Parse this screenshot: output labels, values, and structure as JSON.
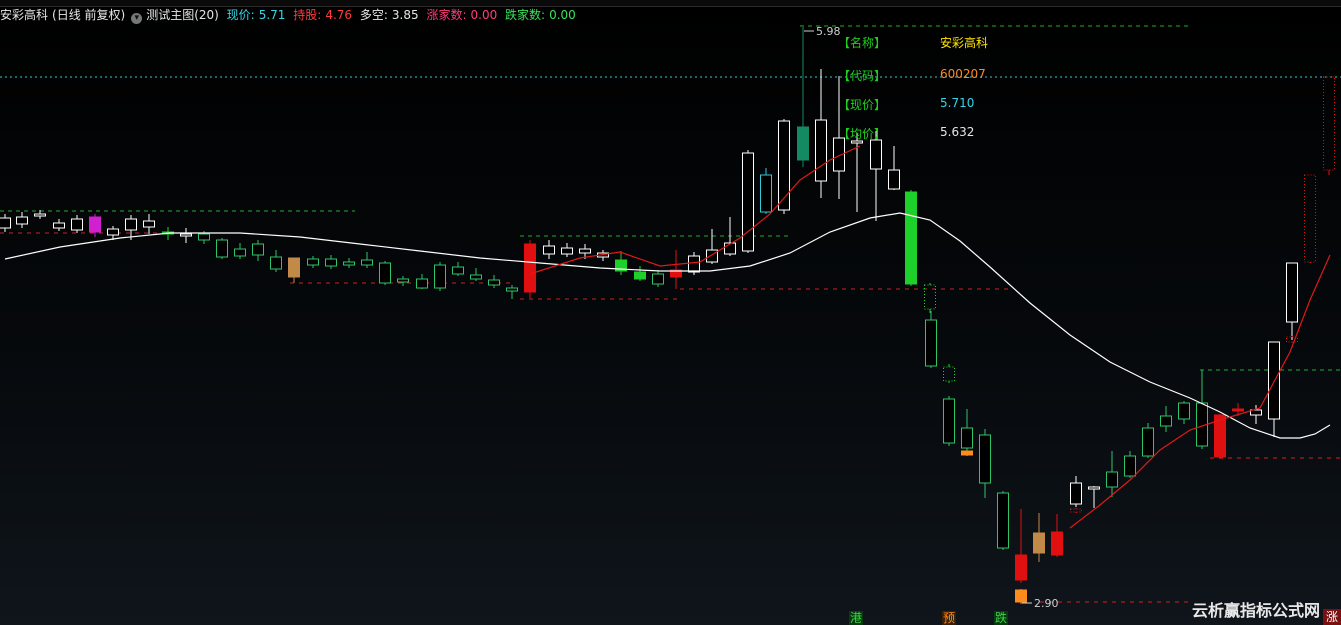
{
  "title_bar": {
    "stock": "安彩高科",
    "period": "(日线 前复权)",
    "indicator": "测试主图(20)",
    "now_label": "现价:",
    "now_value": "5.71",
    "hold_label": "持股:",
    "hold_value": "4.76",
    "dk_label": "多空:",
    "dk_value": "3.85",
    "up_label": "涨家数:",
    "up_value": "0.00",
    "down_label": "跌家数:",
    "down_value": "0.00"
  },
  "info_panel": [
    {
      "label": "【名称】",
      "value": "安彩高科",
      "color": "#ffe600"
    },
    {
      "label": "【代码】",
      "value": "600207",
      "color": "#ff8a1e"
    },
    {
      "label": "【现价】",
      "value": "5.710",
      "color": "#33d6e6"
    },
    {
      "label": "【均价】",
      "value": "5.632",
      "color": "#e6e6e6"
    }
  ],
  "markers": {
    "high": "5.98",
    "low": "2.90"
  },
  "bottom_tags": [
    {
      "text": "港",
      "color": "#3fd04a",
      "bg": "#083a10"
    },
    {
      "text": "预",
      "color": "#ff8a1e",
      "bg": "#3a2005"
    },
    {
      "text": "跌",
      "color": "#3fd04a",
      "bg": "#083a10"
    }
  ],
  "watermark": "云析赢指标公式网",
  "corner_tag": "涨",
  "colors": {
    "up": "#ffffff",
    "down_green": "#2fc46a",
    "down_teal": "#148a62",
    "signal_red": "#e01010",
    "signal_green": "#1ed02a",
    "signal_tan": "#c28a48",
    "signal_magenta": "#d020d0",
    "signal_cyan": "#33c8d8",
    "ma_white": "#ffffff",
    "ma_red": "#e01818"
  }
}
